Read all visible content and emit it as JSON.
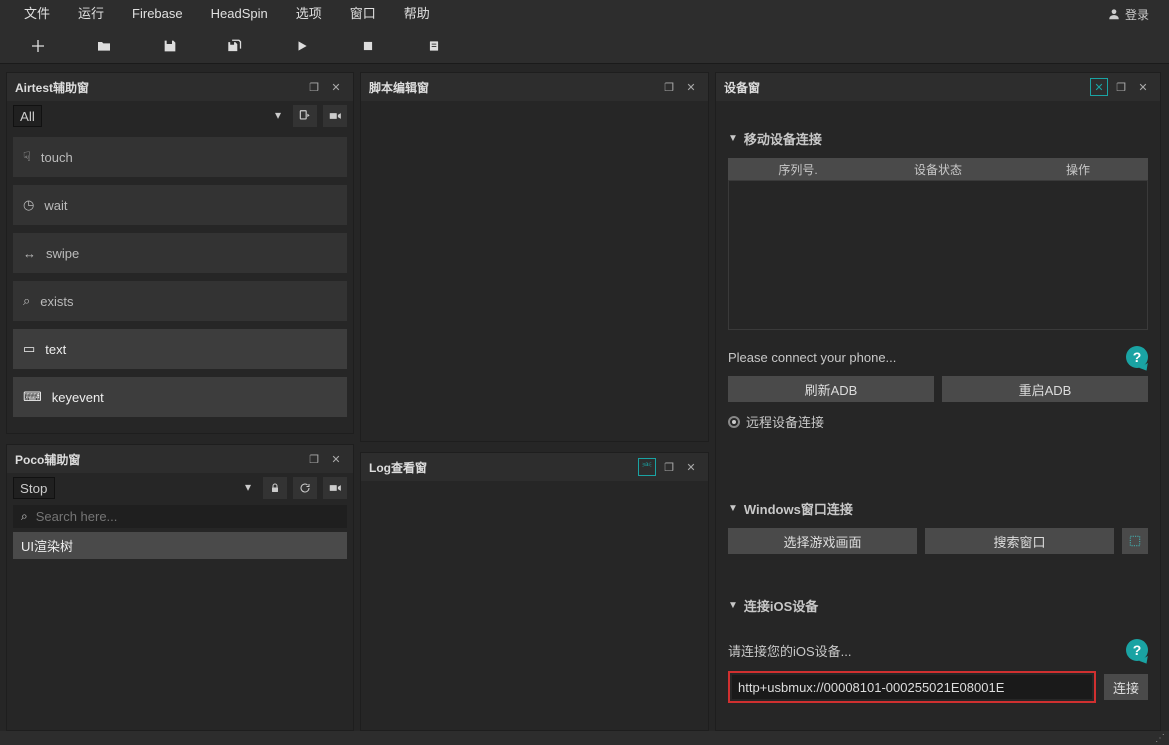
{
  "menubar": {
    "file": "文件",
    "run": "运行",
    "firebase": "Firebase",
    "headspin": "HeadSpin",
    "options": "选项",
    "window": "窗口",
    "help": "帮助",
    "login": "登录"
  },
  "panels": {
    "airtest": {
      "title": "Airtest辅助窗",
      "select": "All",
      "ops": [
        "touch",
        "wait",
        "swipe",
        "exists",
        "text",
        "keyevent"
      ]
    },
    "poco": {
      "title": "Poco辅助窗",
      "select": "Stop",
      "search_placeholder": "Search here...",
      "tree": "UI渲染树"
    },
    "script": {
      "title": "脚本编辑窗"
    },
    "log": {
      "title": "Log查看窗"
    },
    "device": {
      "title": "设备窗"
    }
  },
  "device": {
    "mobile_title": "移动设备连接",
    "cols": {
      "serial": "序列号.",
      "state": "设备状态",
      "action": "操作"
    },
    "connect_msg": "Please connect your phone...",
    "refresh_adb": "刷新ADB",
    "restart_adb": "重启ADB",
    "remote_label": "远程设备连接",
    "windows_title": "Windows窗口连接",
    "choose_window": "选择游戏画面",
    "search_window": "搜索窗口",
    "ios_title": "连接iOS设备",
    "ios_msg": "请连接您的iOS设备...",
    "ios_value": "http+usbmux://00008101-000255021E08001E",
    "connect_btn": "连接"
  }
}
